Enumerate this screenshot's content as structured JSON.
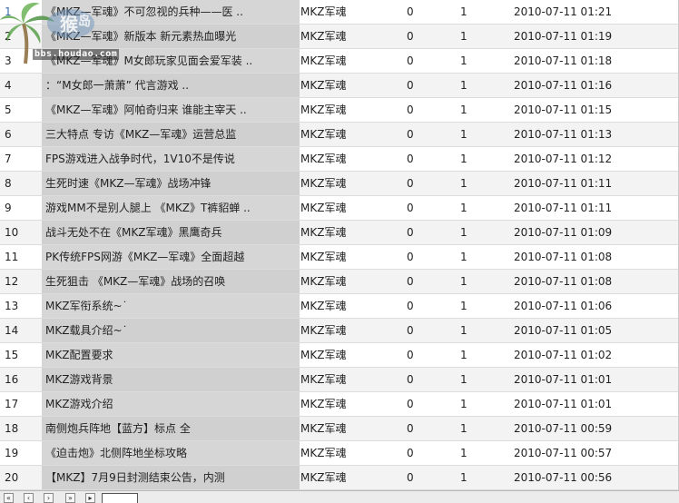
{
  "logo": {
    "url_text": "bbs.houdao.com"
  },
  "rows": [
    {
      "num": "1",
      "title": "《MKZ—军魂》不可忽视的兵种——医 ..",
      "author": "MKZ军魂",
      "replies": "0",
      "views": "1",
      "date": "2010-07-11 01:21"
    },
    {
      "num": "2",
      "title": "《MKZ—军魂》新版本 新元素热血曝光",
      "author": "MKZ军魂",
      "replies": "0",
      "views": "1",
      "date": "2010-07-11 01:19"
    },
    {
      "num": "3",
      "title": "《MKZ—军魂》M女郎玩家见面会爱军装 ..",
      "author": "MKZ军魂",
      "replies": "0",
      "views": "1",
      "date": "2010-07-11 01:18"
    },
    {
      "num": "4",
      "title": "：“M女郎一萧萧” 代言游戏 ..",
      "author": "MKZ军魂",
      "replies": "0",
      "views": "1",
      "date": "2010-07-11 01:16"
    },
    {
      "num": "5",
      "title": "《MKZ—军魂》阿帕奇归来 谁能主宰天 ..",
      "author": "MKZ军魂",
      "replies": "0",
      "views": "1",
      "date": "2010-07-11 01:15"
    },
    {
      "num": "6",
      "title": "三大特点 专访《MKZ—军魂》运营总监",
      "author": "MKZ军魂",
      "replies": "0",
      "views": "1",
      "date": "2010-07-11 01:13"
    },
    {
      "num": "7",
      "title": "FPS游戏进入战争时代，1V10不是传说",
      "author": "MKZ军魂",
      "replies": "0",
      "views": "1",
      "date": "2010-07-11 01:12"
    },
    {
      "num": "8",
      "title": "生死时速《MKZ—军魂》战场冲锋",
      "author": "MKZ军魂",
      "replies": "0",
      "views": "1",
      "date": "2010-07-11 01:11"
    },
    {
      "num": "9",
      "title": "游戏MM不是别人腿上 《MKZ》T裤貂蝉 ..",
      "author": "MKZ军魂",
      "replies": "0",
      "views": "1",
      "date": "2010-07-11 01:11"
    },
    {
      "num": "10",
      "title": "战斗无处不在《MKZ军魂》黑鹰奇兵",
      "author": "MKZ军魂",
      "replies": "0",
      "views": "1",
      "date": "2010-07-11 01:09"
    },
    {
      "num": "11",
      "title": "PK传统FPS网游《MKZ—军魂》全面超越",
      "author": "MKZ军魂",
      "replies": "0",
      "views": "1",
      "date": "2010-07-11 01:08"
    },
    {
      "num": "12",
      "title": "生死狙击 《MKZ—军魂》战场的召唤",
      "author": "MKZ军魂",
      "replies": "0",
      "views": "1",
      "date": "2010-07-11 01:08"
    },
    {
      "num": "13",
      "title": "MKZ军衔系统~˙",
      "author": "MKZ军魂",
      "replies": "0",
      "views": "1",
      "date": "2010-07-11 01:06"
    },
    {
      "num": "14",
      "title": "MKZ载具介绍~˙",
      "author": "MKZ军魂",
      "replies": "0",
      "views": "1",
      "date": "2010-07-11 01:05"
    },
    {
      "num": "15",
      "title": "MKZ配置要求",
      "author": "MKZ军魂",
      "replies": "0",
      "views": "1",
      "date": "2010-07-11 01:02"
    },
    {
      "num": "16",
      "title": "MKZ游戏背景",
      "author": "MKZ军魂",
      "replies": "0",
      "views": "1",
      "date": "2010-07-11 01:01"
    },
    {
      "num": "17",
      "title": "MKZ游戏介绍",
      "author": "MKZ军魂",
      "replies": "0",
      "views": "1",
      "date": "2010-07-11 01:01"
    },
    {
      "num": "18",
      "title": "南侧炮兵阵地【蓝方】标点 全",
      "author": "MKZ军魂",
      "replies": "0",
      "views": "1",
      "date": "2010-07-11 00:59"
    },
    {
      "num": "19",
      "title": "《迫击炮》北侧阵地坐标攻略",
      "author": "MKZ军魂",
      "replies": "0",
      "views": "1",
      "date": "2010-07-11 00:57"
    },
    {
      "num": "20",
      "title": "【MKZ】7月9日封测结束公告，内测",
      "author": "MKZ军魂",
      "replies": "0",
      "views": "1",
      "date": "2010-07-11 00:56"
    }
  ],
  "colors": {
    "row_bg": "#ffffff",
    "row_alt_bg": "#f3f3f3",
    "title_cell_bg": "#d6d6d6",
    "num_first_color": "#3a6fb0"
  },
  "pager": {
    "buttons": [
      "first-page",
      "previous-page",
      "next-page",
      "last-page"
    ],
    "page_input_value": ""
  }
}
